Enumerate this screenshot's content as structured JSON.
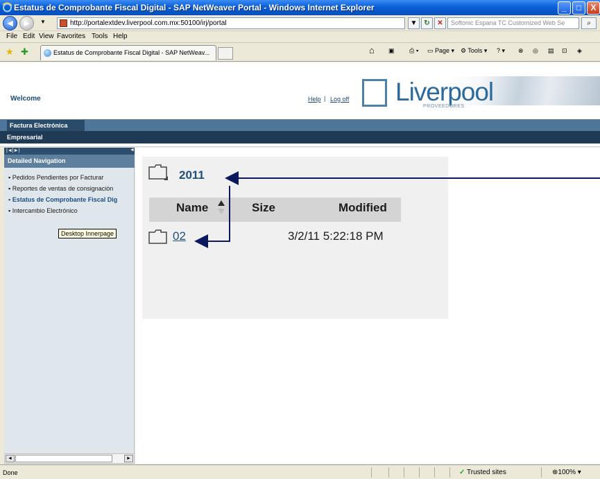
{
  "window": {
    "title": "Estatus de Comprobante Fiscal Digital - SAP NetWeaver Portal - Windows Internet Explorer",
    "minimize_label": "_",
    "maximize_label": "□",
    "close_label": "X"
  },
  "address": {
    "url": "http://portalextdev.liverpool.com.mx:50100/irj/portal",
    "search_placeholder": "Softonic Espana TC Customized Web Se"
  },
  "menu": [
    "File",
    "Edit",
    "View",
    "Favorites",
    "Tools",
    "Help"
  ],
  "tab": {
    "label": "Estatus de Comprobante Fiscal Digital - SAP NetWeav..."
  },
  "commandbar": {
    "page_label": "Page",
    "tools_label": "Tools"
  },
  "portal": {
    "welcome": "Welcome",
    "help_link": "Help",
    "separator": "|",
    "logoff_link": "Log off",
    "logo_text": "Liverpool",
    "logo_sub": "PROVEEDORES",
    "top_tab": "Factura Electrónica",
    "second_nav": "Empresarial"
  },
  "detailed_nav": {
    "tool_glyphs": "|◄|►|",
    "title": "Detailed Navigation",
    "items": [
      "Pedidos Pendientes por Facturar",
      "Reportes de ventas de consignación",
      "Estatus de Comprobante Fiscal Dig",
      "Intercambio Electrónico"
    ],
    "selected_index": 2,
    "tooltip": "Desktop Innerpage"
  },
  "content": {
    "folder_title": "2011",
    "columns": {
      "name": "Name",
      "size": "Size",
      "modified": "Modified"
    },
    "rows": [
      {
        "name": "02",
        "size": "",
        "modified": "3/2/11 5:22:18 PM"
      }
    ]
  },
  "status": {
    "text": "Done",
    "zone": "Trusted sites",
    "zoom": "100%"
  },
  "colors": {
    "accent_navy": "#1f3a55",
    "link_blue": "#1f4f7a",
    "annotation_arrow": "#0b1a5e"
  }
}
